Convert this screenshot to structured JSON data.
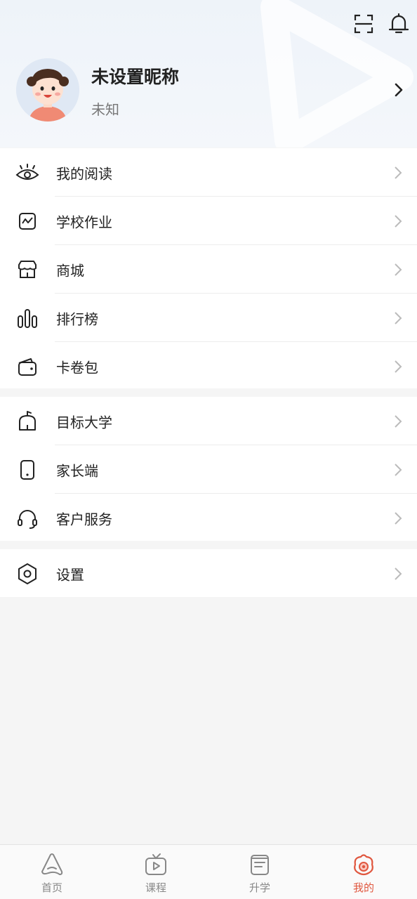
{
  "profile": {
    "nickname": "未设置昵称",
    "gender": "未知"
  },
  "menu_group1": [
    {
      "label": "我的阅读",
      "icon": "eye-icon"
    },
    {
      "label": "学校作业",
      "icon": "chart-square-icon"
    },
    {
      "label": "商城",
      "icon": "store-icon"
    },
    {
      "label": "排行榜",
      "icon": "bars-icon"
    },
    {
      "label": "卡卷包",
      "icon": "wallet-icon"
    }
  ],
  "menu_group2": [
    {
      "label": "目标大学",
      "icon": "university-icon"
    },
    {
      "label": "家长端",
      "icon": "phone-icon"
    },
    {
      "label": "客户服务",
      "icon": "headset-icon"
    }
  ],
  "menu_group3": [
    {
      "label": "设置",
      "icon": "hexagon-gear-icon"
    }
  ],
  "tabs": [
    {
      "label": "首页",
      "icon": "home-a-icon",
      "active": false
    },
    {
      "label": "课程",
      "icon": "tv-play-icon",
      "active": false
    },
    {
      "label": "升学",
      "icon": "document-icon",
      "active": false
    },
    {
      "label": "我的",
      "icon": "profile-face-icon",
      "active": true
    }
  ],
  "colors": {
    "accent": "#e0573f",
    "header_bg": "#eef3f9",
    "page_bg": "#f5f5f5",
    "icon_stroke": "#222222"
  }
}
